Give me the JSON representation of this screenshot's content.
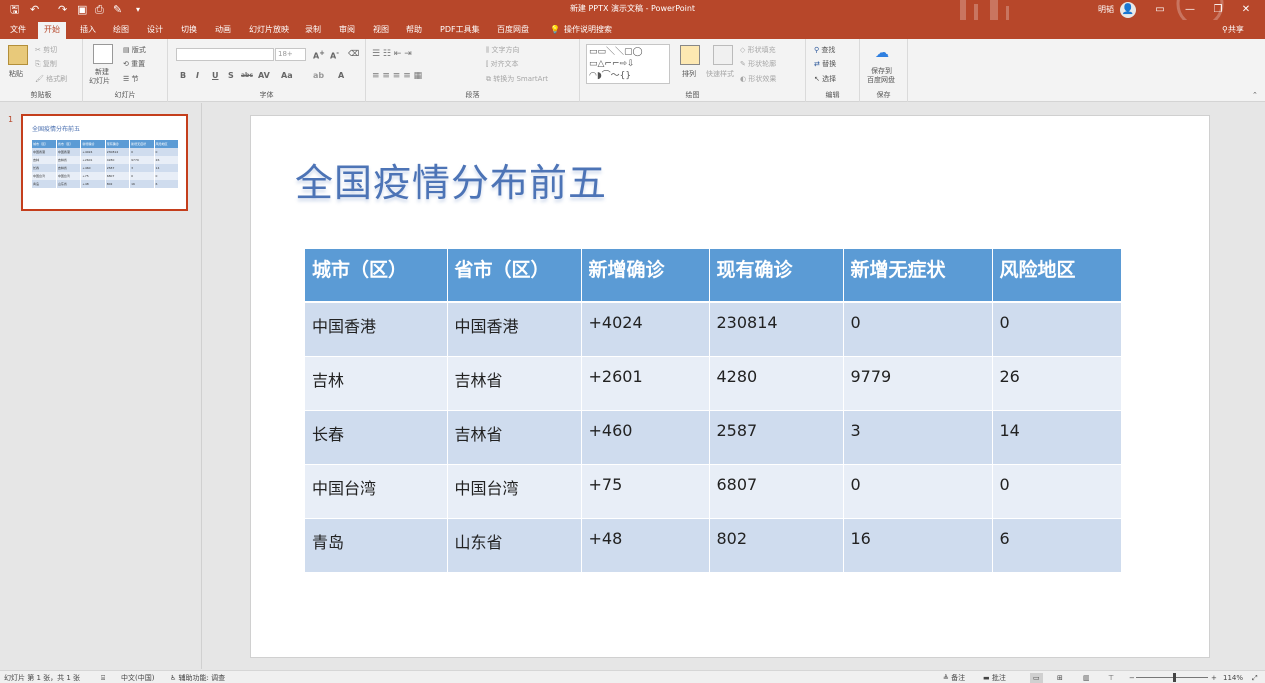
{
  "app": {
    "title": "新建 PPTX 演示文稿 - PowerPoint",
    "user": "明韬",
    "avatar_initial": "👤",
    "share_label": "共享",
    "accent": "#b7472a"
  },
  "quick_access": [
    "save-icon",
    "undo-icon",
    "redo-icon",
    "present-icon",
    "preview-icon",
    "format-painter-icon",
    "customize-icon"
  ],
  "tabs": [
    "文件",
    "开始",
    "插入",
    "绘图",
    "设计",
    "切换",
    "动画",
    "幻灯片放映",
    "录制",
    "审阅",
    "视图",
    "帮助",
    "PDF工具集",
    "百度网盘",
    "操作说明搜索"
  ],
  "ribbon": {
    "clipboard": {
      "label": "剪贴板",
      "paste": "粘贴",
      "cut": "剪切",
      "copy": "复制",
      "painter": "格式刷"
    },
    "slides": {
      "label": "幻灯片",
      "new_slide": "新建",
      "new_slide2": "幻灯片",
      "layout": "版式",
      "reset": "重置",
      "section": "节"
    },
    "font": {
      "label": "字体",
      "size": "18+",
      "buttons": [
        "B",
        "I",
        "U",
        "S",
        "abc",
        "AV",
        "Aa",
        "A"
      ]
    },
    "paragraph": {
      "label": "段落",
      "text_direction": "文字方向",
      "align_text": "对齐文本",
      "smartart": "转换为 SmartArt"
    },
    "drawing": {
      "label": "绘图",
      "arrange": "排列",
      "quick_styles": "快速样式",
      "shape_fill": "形状填充",
      "shape_outline": "形状轮廓",
      "shape_effects": "形状效果"
    },
    "editing": {
      "label": "编辑",
      "find": "查找",
      "replace": "替换",
      "select": "选择"
    },
    "save": {
      "label": "保存",
      "save_to": "保存到",
      "baidu": "百度网盘"
    }
  },
  "slide_panel": {
    "number": "1"
  },
  "slide": {
    "title": "全国疫情分布前五",
    "table": {
      "headers": [
        "城市（区）",
        "省市（区）",
        "新增确诊",
        "现有确诊",
        "新增无症状",
        "风险地区"
      ],
      "rows": [
        [
          "中国香港",
          "中国香港",
          "+4024",
          "230814",
          "0",
          "0"
        ],
        [
          "吉林",
          "吉林省",
          "+2601",
          "4280",
          "9779",
          "26"
        ],
        [
          "长春",
          "吉林省",
          "+460",
          "2587",
          "3",
          "14"
        ],
        [
          "中国台湾",
          "中国台湾",
          "+75",
          "6807",
          "0",
          "0"
        ],
        [
          "青岛",
          "山东省",
          "+48",
          "802",
          "16",
          "6"
        ]
      ]
    }
  },
  "status": {
    "slide_info": "幻灯片 第 1 张，共 1 张",
    "language": "中文(中国)",
    "accessibility": "辅助功能: 调查",
    "notes": "备注",
    "comments": "批注",
    "zoom": "114%"
  }
}
